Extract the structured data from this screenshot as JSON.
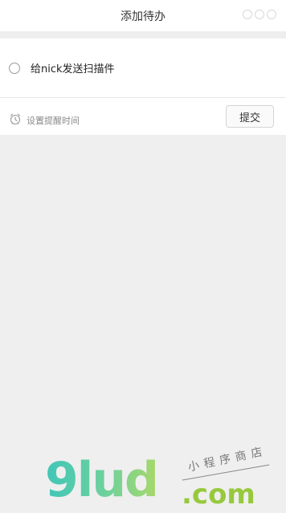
{
  "header": {
    "title": "添加待办"
  },
  "todo": {
    "text": "给nick发送扫描件",
    "checked": false
  },
  "reminder": {
    "label": "设置提醒时间",
    "icon": "alarm-clock-icon"
  },
  "actions": {
    "submit_label": "提交"
  },
  "watermark": {
    "logo": "9lud",
    "domain_suffix": ".com",
    "tagline": "小程序商店"
  },
  "colors": {
    "background": "#efefef",
    "card": "#ffffff",
    "watermark_gradient_start": "#40c6b8",
    "watermark_gradient_end": "#a8d86a",
    "watermark_com": "#97c93c"
  }
}
